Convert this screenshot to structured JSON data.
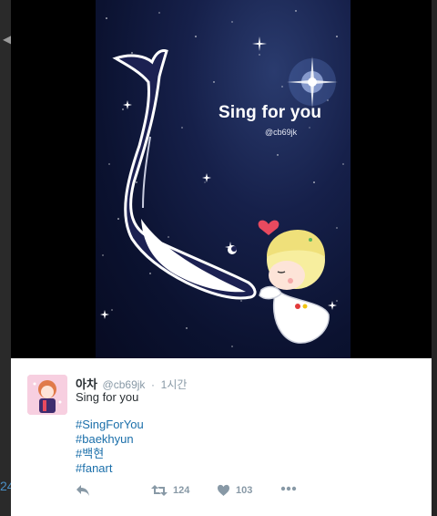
{
  "nav": {
    "prev_icon": "chevron-left-icon",
    "peek_text": "24"
  },
  "media": {
    "title": "Sing for you",
    "credit": "@cb69jk",
    "colors": {
      "sky": "#0b1230",
      "whale": "#1a1f4a",
      "heart": "#e84a5f"
    }
  },
  "tweet": {
    "display_name": "아차",
    "handle": "@cb69jk",
    "separator": "·",
    "time": "1시간",
    "text": "Sing for you",
    "hashtags": [
      "#SingForYou",
      "#baekhyun",
      "#백현",
      "#fanart"
    ],
    "actions": {
      "reply_icon": "reply-icon",
      "retweet_icon": "retweet-icon",
      "retweet_count": "124",
      "like_icon": "heart-icon",
      "like_count": "103",
      "more_icon": "more-icon"
    },
    "colors": {
      "link": "#1b6faa",
      "muted": "#8899a6",
      "text": "#292f33"
    }
  }
}
